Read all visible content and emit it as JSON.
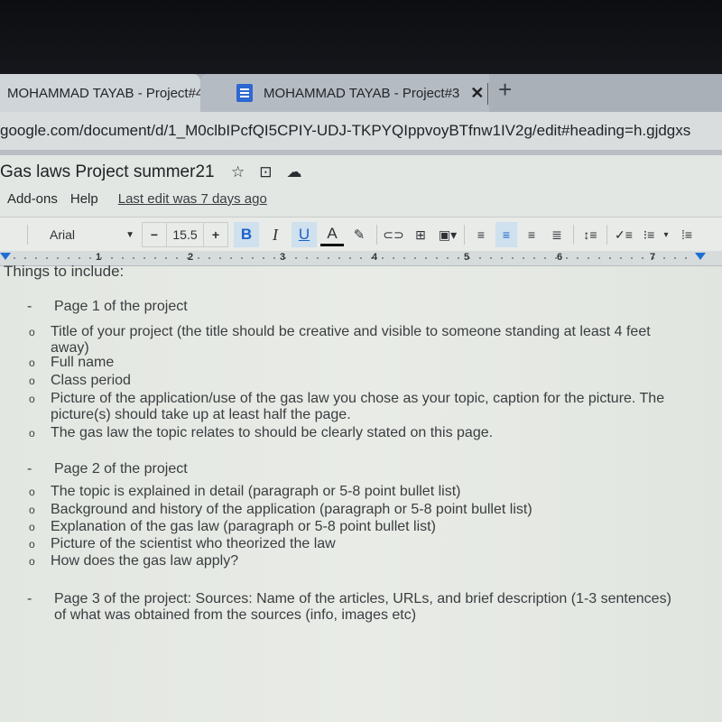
{
  "browser": {
    "tabs": [
      {
        "title": "MOHAMMAD TAYAB - Project#4",
        "active": true,
        "close_label": "✕"
      },
      {
        "title": "MOHAMMAD TAYAB - Project#3",
        "active": false,
        "close_label": "✕"
      }
    ],
    "new_tab_label": "+",
    "url": "google.com/document/d/1_M0clbIPcfQI5CPIY-UDJ-TKPYQIppvoyBTfnw1IV2g/edit#heading=h.gjdgxs",
    "accent_color": "#2d67d1"
  },
  "docs": {
    "title": "Gas laws Project summer21",
    "title_icons": [
      "star-icon",
      "move-to-folder-icon",
      "cloud-status-icon"
    ],
    "menu": [
      "Add-ons",
      "Help"
    ],
    "last_edit": "Last edit was 7 days ago",
    "toolbar": {
      "font": "Arial",
      "font_size": "15.5",
      "minus": "−",
      "plus": "+",
      "bold": "B",
      "italic": "I",
      "underline": "U",
      "text_color": "A",
      "highlight": "✎",
      "link": "⊂⊃",
      "comment": "⊞",
      "image": "▣▾",
      "align_left": "≡",
      "align_center": "≡",
      "align_right": "≡",
      "justify": "≣",
      "line_spacing": "↕≡",
      "checklist": "✓≡",
      "bullets": "⁝≡",
      "bullets_dropdown": "▾",
      "numbered": "⁞≡"
    },
    "ruler": [
      "1",
      "2",
      "3",
      "4",
      "5",
      "6",
      "7"
    ]
  },
  "document": {
    "clipped_heading": "Things to include:",
    "sections": [
      {
        "marker": "-",
        "heading": "Page 1 of the project",
        "items": [
          {
            "bullet": "o",
            "text": "Title of your project (the title should be creative and visible to someone standing at least 4 feet away)"
          },
          {
            "bullet": "o",
            "text": "Full name"
          },
          {
            "bullet": "o",
            "text": "Class period"
          },
          {
            "bullet": "o",
            "text": "Picture of the application/use of the gas law you chose as your topic, caption for the picture. The picture(s) should take up at least half the page."
          },
          {
            "bullet": "o",
            "text": "The gas law the topic relates to should be clearly stated on this page."
          }
        ]
      },
      {
        "marker": "-",
        "heading": "Page 2 of the project",
        "items": [
          {
            "bullet": "o",
            "text": "The topic is explained in detail (paragraph or 5-8 point bullet list)"
          },
          {
            "bullet": "o",
            "text": "Background and history of the application (paragraph or 5-8 point bullet list)"
          },
          {
            "bullet": "o",
            "text": "Explanation of the gas law (paragraph or 5-8 point bullet list)"
          },
          {
            "bullet": "o",
            "text": "Picture of the scientist who theorized the law"
          },
          {
            "bullet": "o",
            "text": "How does the gas law apply?"
          }
        ]
      },
      {
        "marker": "-",
        "heading": "Page 3 of the project: Sources: Name of the articles, URLs, and brief description (1-3 sentences)  of what was obtained from the sources (info, images etc)"
      }
    ]
  }
}
